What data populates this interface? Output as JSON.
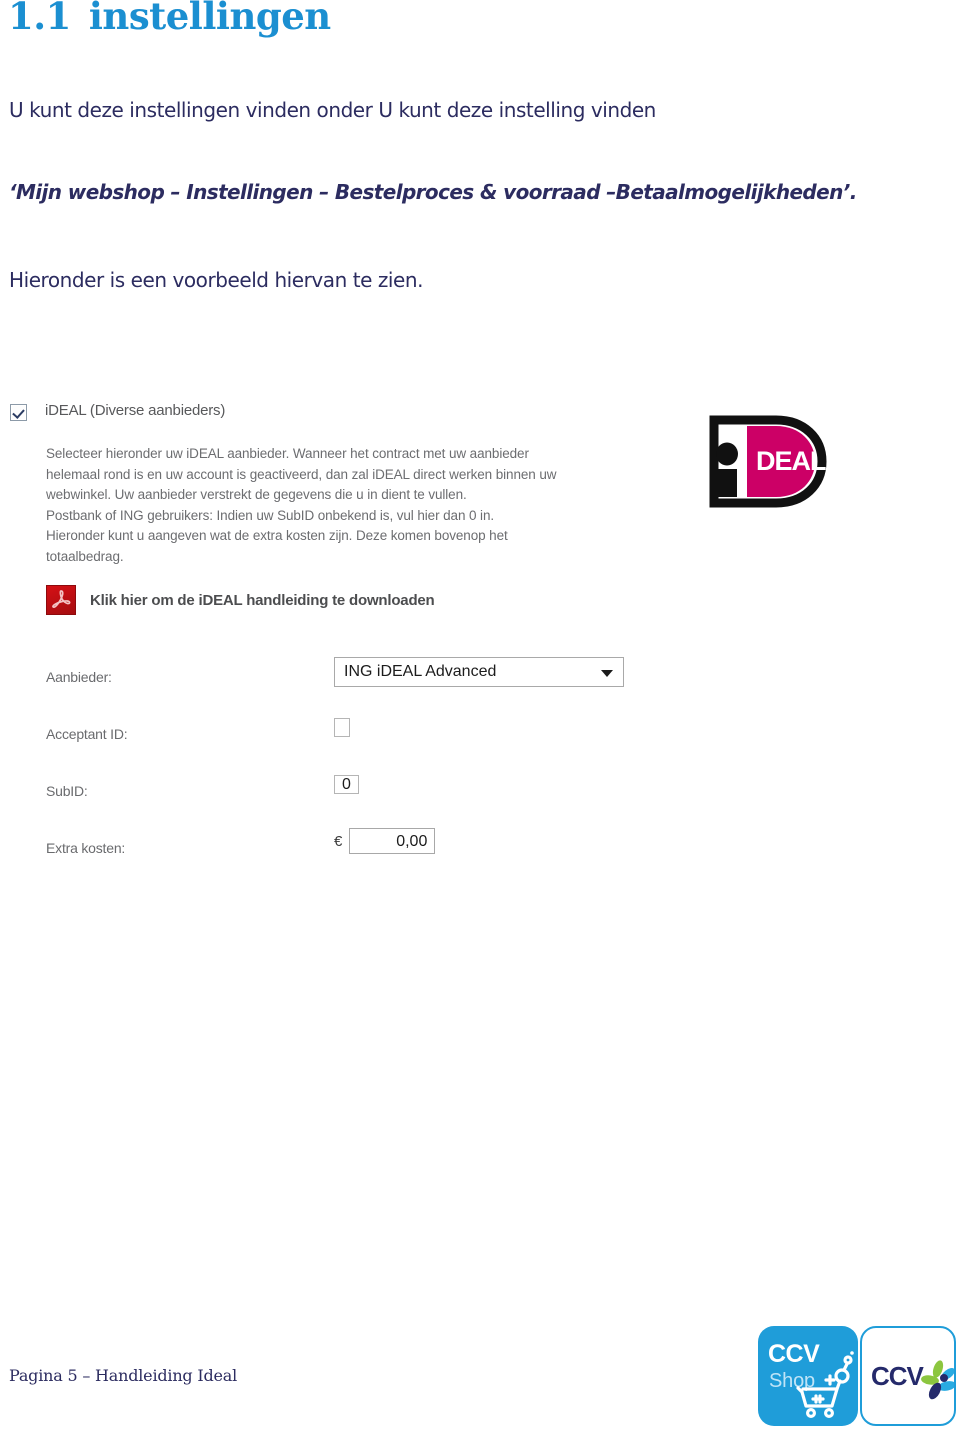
{
  "document": {
    "heading_number": "1.1",
    "heading_title": "instellingen",
    "paragraph_1": "U kunt deze instellingen vinden onder U kunt deze instelling vinden",
    "paragraph_2": "‘Mijn webshop – Instellingen – Bestelproces & voorraad –Betaalmogelijkheden’.",
    "paragraph_3": "Hieronder is een voorbeeld hiervan te zien."
  },
  "screenshot": {
    "checkbox_label": "iDEAL (Diverse aanbieders)",
    "checkbox_checked": true,
    "description_lines": [
      "Selecteer hieronder uw iDEAL aanbieder. Wanneer het contract met uw aanbieder",
      "helemaal rond is en uw account is geactiveerd, dan zal iDEAL direct werken binnen uw",
      "webwinkel. Uw aanbieder verstrekt de gegevens die u in dient te vullen.",
      "Postbank of ING gebruikers: Indien uw SubID onbekend is, vul hier dan 0 in.",
      "Hieronder kunt u aangeven wat de extra kosten zijn. Deze komen bovenop het",
      "totaalbedrag."
    ],
    "pdf_link_label": "Klik hier om de iDEAL handleiding te downloaden",
    "pdf_icon_name": "pdf-acrobat-icon",
    "ideal_logo_text": "iDEAL",
    "form": {
      "provider_label": "Aanbieder:",
      "provider_value": "ING iDEAL Advanced",
      "acceptant_label": "Acceptant ID:",
      "acceptant_value": "",
      "acceptant_placeholder": "",
      "subid_label": "SubID:",
      "subid_value": "0",
      "extra_label": "Extra kosten:",
      "currency_symbol": "€",
      "extra_value": "0,00"
    }
  },
  "footer": {
    "page_note": "Pagina 5 – Handleiding Ideal",
    "logo_ccvshop_line1": "CCV",
    "logo_ccvshop_line2": "Shop",
    "logo_ccv_text": "CCV"
  },
  "colors": {
    "heading_blue": "#1b8fd1",
    "body_navy": "#2c2c60",
    "ideal_magenta": "#cc0066",
    "pdf_red": "#d51015",
    "ccv_blue": "#1f9dd9",
    "ccv_navy": "#252a6b"
  }
}
